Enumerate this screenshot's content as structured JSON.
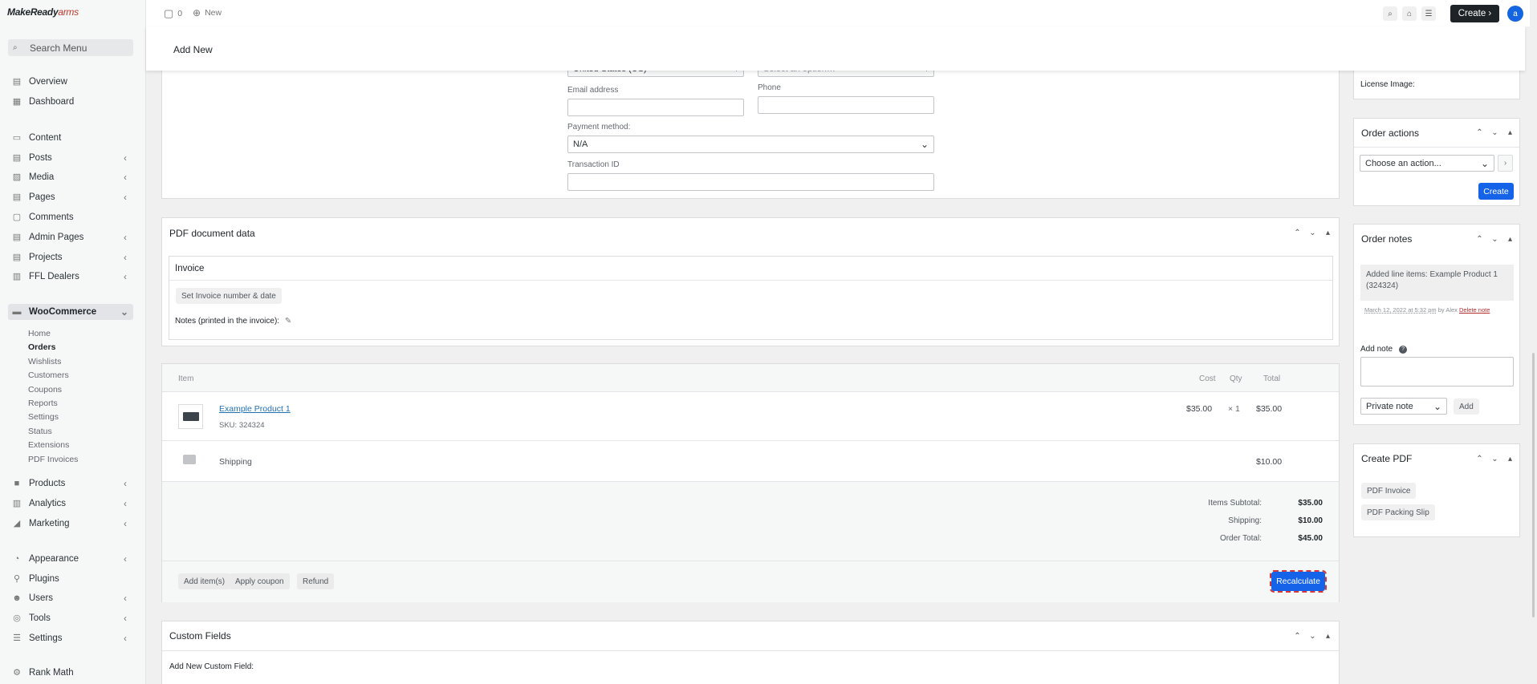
{
  "brand": {
    "part1": "MakeReady",
    "part2": "arms"
  },
  "sidebar": {
    "search_placeholder": "Search Menu",
    "items": [
      {
        "label": "Overview",
        "icon": "overview-icon",
        "glyph": "▤",
        "chev": ""
      },
      {
        "label": "Dashboard",
        "icon": "dashboard-icon",
        "glyph": "▦",
        "chev": ""
      },
      {
        "label": "Content",
        "icon": "content-icon",
        "glyph": "▭",
        "chev": ""
      },
      {
        "label": "Posts",
        "icon": "posts-icon",
        "glyph": "▤",
        "chev": "‹"
      },
      {
        "label": "Media",
        "icon": "media-icon",
        "glyph": "▨",
        "chev": "‹"
      },
      {
        "label": "Pages",
        "icon": "pages-icon",
        "glyph": "▤",
        "chev": "‹"
      },
      {
        "label": "Comments",
        "icon": "comments-icon",
        "glyph": "▢",
        "chev": ""
      },
      {
        "label": "Admin Pages",
        "icon": "admin-pages-icon",
        "glyph": "▤",
        "chev": "‹"
      },
      {
        "label": "Projects",
        "icon": "projects-icon",
        "glyph": "▤",
        "chev": "‹"
      },
      {
        "label": "FFL Dealers",
        "icon": "ffl-dealers-icon",
        "glyph": "▥",
        "chev": "‹"
      },
      {
        "label": "WooCommerce",
        "icon": "woocommerce-icon",
        "glyph": "▬",
        "chev": "⌄"
      },
      {
        "label": "Products",
        "icon": "products-icon",
        "glyph": "■",
        "chev": "‹"
      },
      {
        "label": "Analytics",
        "icon": "analytics-icon",
        "glyph": "▥",
        "chev": "‹"
      },
      {
        "label": "Marketing",
        "icon": "marketing-icon",
        "glyph": "◢",
        "chev": "‹"
      },
      {
        "label": "Appearance",
        "icon": "appearance-icon",
        "glyph": "◔",
        "chev": "‹"
      },
      {
        "label": "Plugins",
        "icon": "plugins-icon",
        "glyph": "⚲",
        "chev": ""
      },
      {
        "label": "Users",
        "icon": "users-icon",
        "glyph": "☻",
        "chev": "‹"
      },
      {
        "label": "Tools",
        "icon": "tools-icon",
        "glyph": "◎",
        "chev": "‹"
      },
      {
        "label": "Settings",
        "icon": "settings-icon",
        "glyph": "☰",
        "chev": "‹"
      },
      {
        "label": "Rank Math",
        "icon": "rank-math-icon",
        "glyph": "⚙",
        "chev": ""
      }
    ],
    "woo_sub": [
      "Home",
      "Orders",
      "Wishlists",
      "Customers",
      "Coupons",
      "Reports",
      "Settings",
      "Status",
      "Extensions",
      "PDF Invoices"
    ]
  },
  "topbar": {
    "comments_count": "0",
    "new_label": "New",
    "create_label": "Create ›",
    "avatar_letter": "a"
  },
  "subheader": {
    "title": "Add New"
  },
  "billing": {
    "country_value": "United States (US)",
    "state_value": "Select an option…",
    "email_label": "Email address",
    "phone_label": "Phone",
    "payment_label": "Payment method:",
    "payment_value": "N/A",
    "transaction_label": "Transaction ID"
  },
  "pdf_data": {
    "title": "PDF document data",
    "invoice_title": "Invoice",
    "set_button": "Set Invoice number & date",
    "notes_label": "Notes (printed in the invoice):"
  },
  "items": {
    "headers": {
      "item": "Item",
      "cost": "Cost",
      "qty": "Qty",
      "total": "Total"
    },
    "product": {
      "name": "Example Product 1",
      "sku_label": "SKU:",
      "sku": "324324",
      "cost": "$35.00",
      "qty": "× 1",
      "total": "$35.00"
    },
    "shipping": {
      "label": "Shipping",
      "total": "$10.00"
    },
    "totals": [
      {
        "label": "Items Subtotal:",
        "value": "$35.00"
      },
      {
        "label": "Shipping:",
        "value": "$10.00"
      },
      {
        "label": "Order Total:",
        "value": "$45.00"
      }
    ],
    "actions": {
      "add_items": "Add item(s)",
      "apply_coupon": "Apply coupon",
      "refund": "Refund",
      "recalculate": "Recalculate"
    }
  },
  "custom_fields": {
    "title": "Custom Fields",
    "add_label": "Add New Custom Field:"
  },
  "right": {
    "license_label": "License Image:",
    "order_actions": {
      "title": "Order actions",
      "select_value": "Choose an action...",
      "create": "Create"
    },
    "order_notes": {
      "title": "Order notes",
      "note_text": "Added line items: Example Product 1 (324324)",
      "note_date": "March 12, 2022 at 5:32 pm",
      "note_by": "by Alex",
      "delete": "Delete note",
      "add_note_label": "Add note",
      "note_type": "Private note",
      "add_button": "Add"
    },
    "create_pdf": {
      "title": "Create PDF",
      "invoice": "PDF Invoice",
      "packing": "PDF Packing Slip"
    }
  }
}
